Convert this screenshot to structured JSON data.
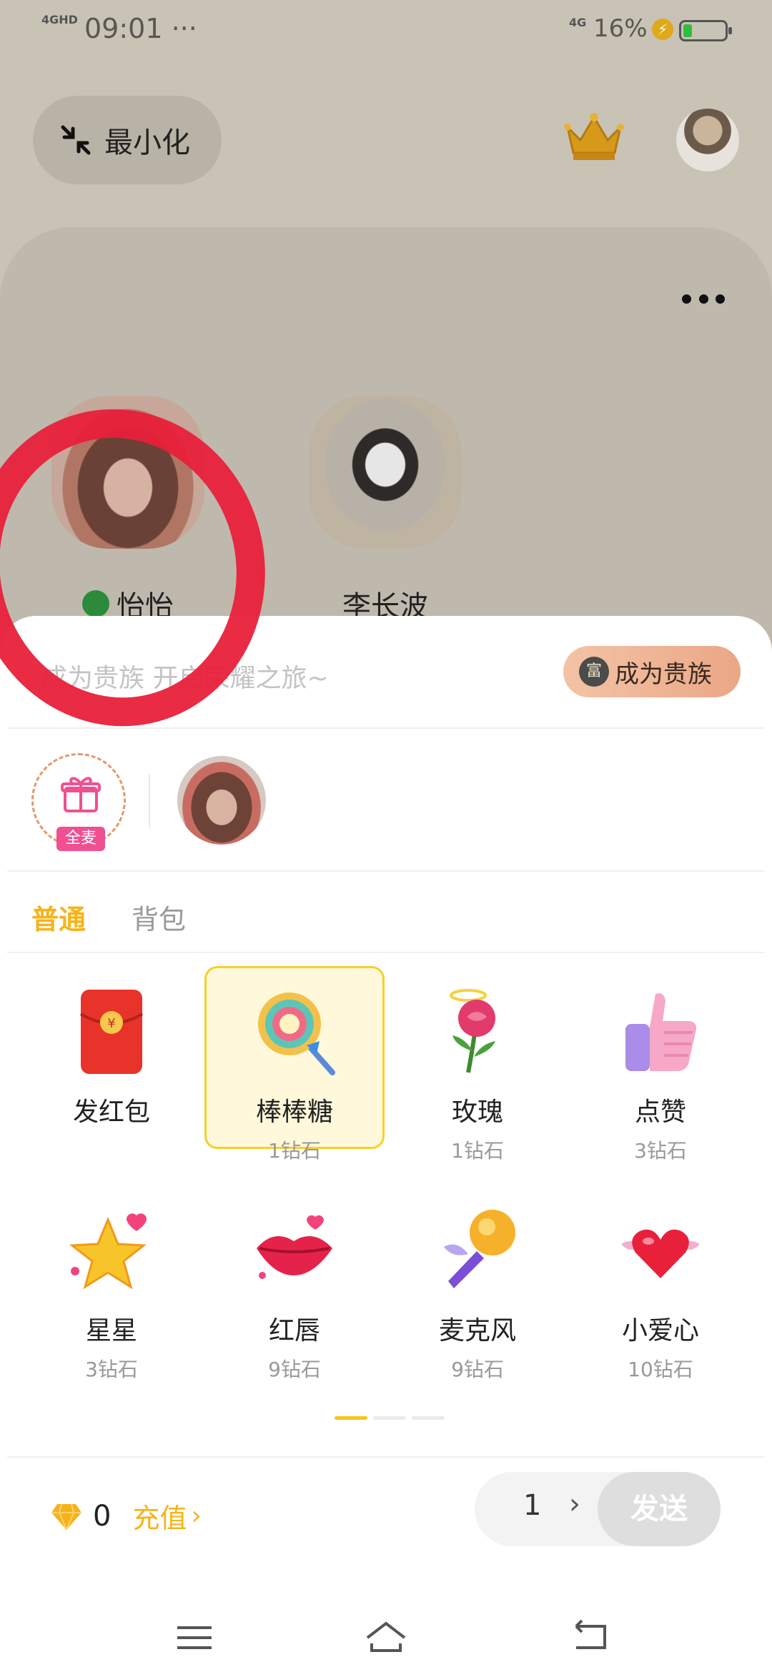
{
  "status_bar": {
    "network": "4GHD",
    "time": "09:01 ···",
    "network2": "4G",
    "battery_percent": "16%"
  },
  "background": {
    "minimize_label": "最小化",
    "seats": [
      {
        "name": "怡怡"
      },
      {
        "name": "李长波"
      }
    ]
  },
  "sheet": {
    "noble_hint": "成为贵族 开启荣耀之旅~",
    "noble_button": "成为贵族",
    "all_mic_badge": "全麦",
    "tabs": [
      {
        "label": "普通",
        "active": true
      },
      {
        "label": "背包",
        "active": false
      }
    ],
    "gifts": [
      {
        "name": "发红包",
        "price": "",
        "icon": "red-envelope-icon"
      },
      {
        "name": "棒棒糖",
        "price": "1钻石",
        "icon": "lollipop-icon",
        "selected": true
      },
      {
        "name": "玫瑰",
        "price": "1钻石",
        "icon": "rose-icon"
      },
      {
        "name": "点赞",
        "price": "3钻石",
        "icon": "thumbs-up-icon"
      },
      {
        "name": "星星",
        "price": "3钻石",
        "icon": "star-icon"
      },
      {
        "name": "红唇",
        "price": "9钻石",
        "icon": "lips-icon"
      },
      {
        "name": "麦克风",
        "price": "9钻石",
        "icon": "microphone-icon"
      },
      {
        "name": "小爱心",
        "price": "10钻石",
        "icon": "heart-icon"
      }
    ],
    "balance": {
      "count": "0",
      "recharge_label": "充值"
    },
    "send": {
      "quantity": "1",
      "label": "发送"
    }
  },
  "colors": {
    "accent": "#f6b31b",
    "annotation": "#e8203a",
    "selected_bg": "#fff8db"
  }
}
